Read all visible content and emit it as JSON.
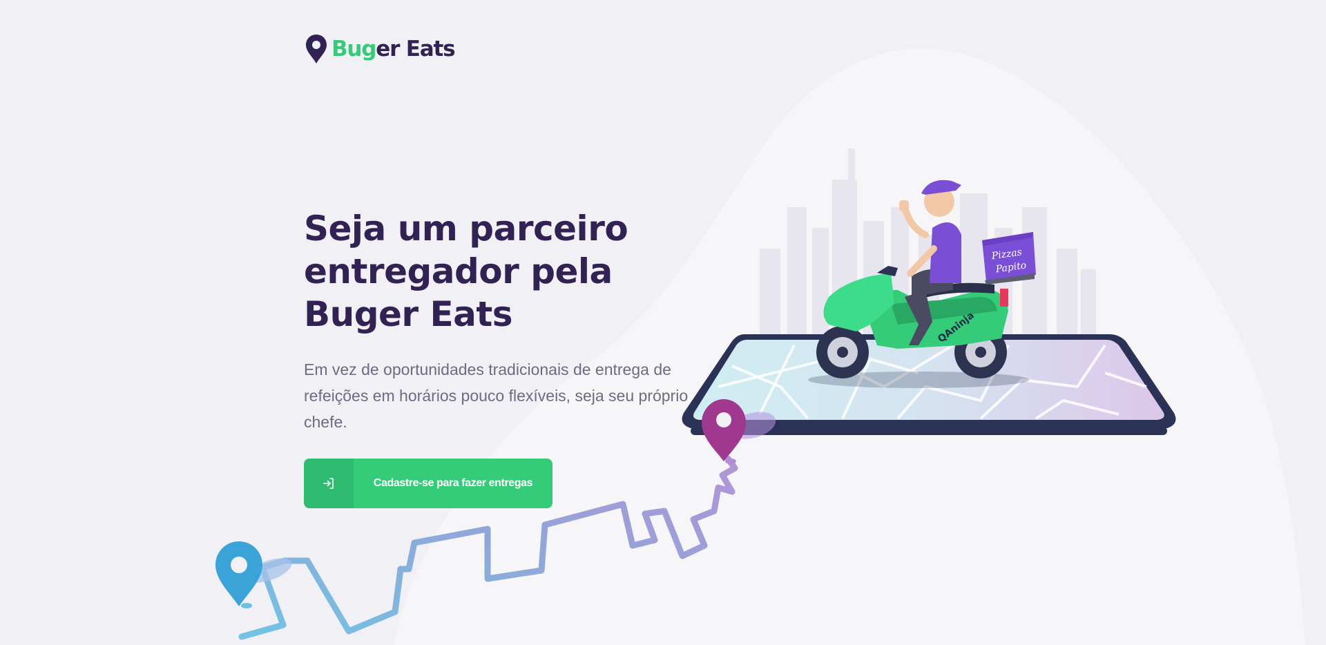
{
  "brand": {
    "name_part1": "Bug",
    "name_part2": "er Eats",
    "pin_color": "#322153",
    "accent_color": "#34cb79"
  },
  "hero": {
    "title": "Seja um parceiro entregador pela Buger Eats",
    "description": "Em vez de oportunidades tradicionais de entrega de refeições em horários pouco flexíveis, seja seu próprio chefe."
  },
  "cta": {
    "label": "Cadastre-se para fazer entregas",
    "icon": "sign-in-icon"
  },
  "illustration": {
    "box_line1": "Pizzas",
    "box_line2": "Papito",
    "scooter_brand": "QAninja"
  }
}
